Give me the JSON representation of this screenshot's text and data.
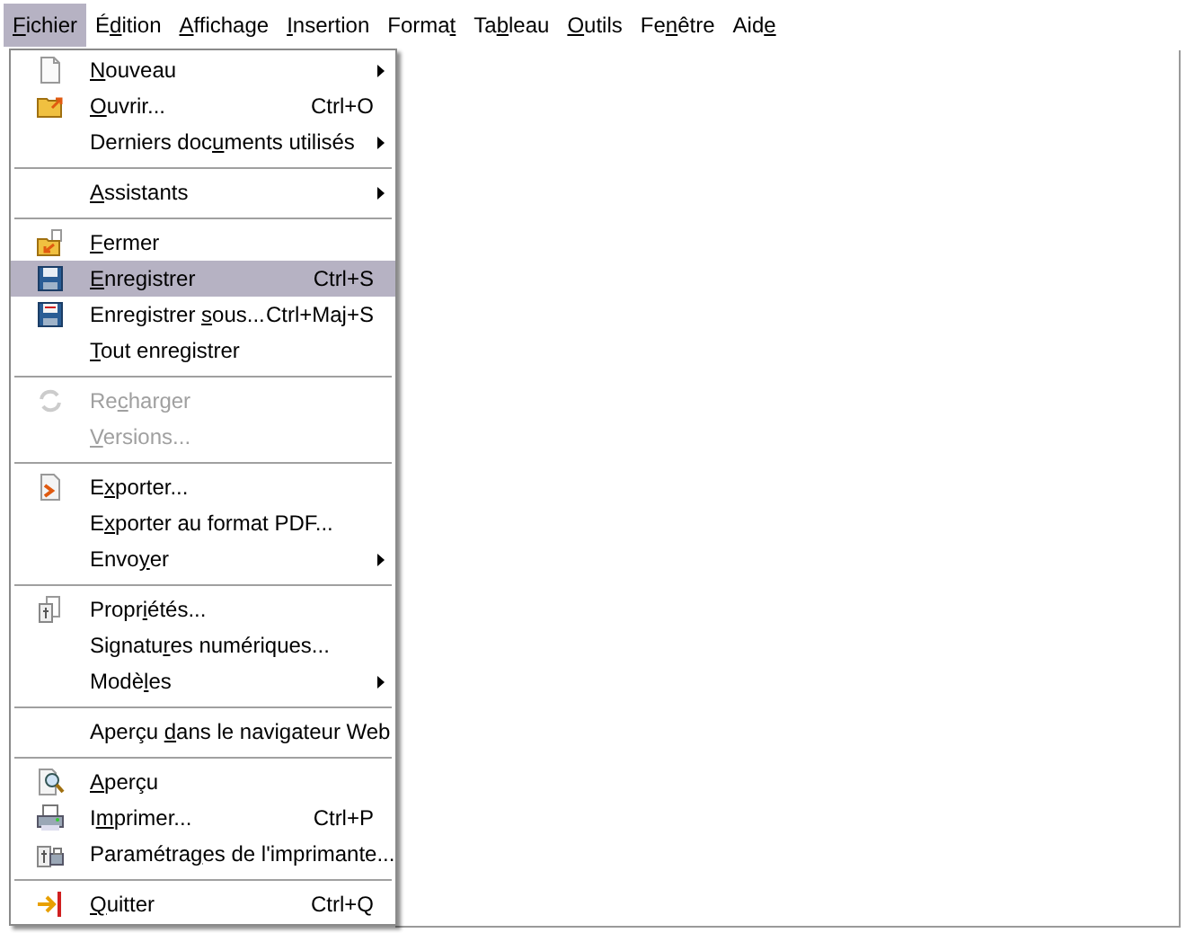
{
  "menubar": [
    {
      "key": "F",
      "after": "ichier",
      "selected": true
    },
    {
      "before": "É",
      "key": "d",
      "after": "ition",
      "selected": false
    },
    {
      "key": "A",
      "after": "ffichage",
      "selected": false
    },
    {
      "key": "I",
      "after": "nsertion",
      "selected": false
    },
    {
      "before": "Forma",
      "key": "t",
      "selected": false
    },
    {
      "before": "Ta",
      "key": "b",
      "after": "leau",
      "selected": false
    },
    {
      "key": "O",
      "after": "utils",
      "selected": false
    },
    {
      "before": "Fe",
      "key": "n",
      "after": "être",
      "selected": false
    },
    {
      "before": "Aid",
      "key": "e",
      "selected": false
    }
  ],
  "menu": [
    {
      "kind": "item",
      "key": "N",
      "after": "ouveau",
      "submenu": true,
      "selected": false,
      "disabled": false
    },
    {
      "kind": "item",
      "key": "O",
      "after": "uvrir...",
      "shortcut": "Ctrl+O",
      "submenu": false,
      "selected": false,
      "disabled": false
    },
    {
      "kind": "item",
      "before": "Derniers doc",
      "key": "u",
      "after": "ments utilisés",
      "submenu": true,
      "selected": false,
      "disabled": false
    },
    {
      "kind": "separator"
    },
    {
      "kind": "item",
      "key": "A",
      "after": "ssistants",
      "submenu": true,
      "selected": false,
      "disabled": false
    },
    {
      "kind": "separator"
    },
    {
      "kind": "item",
      "key": "F",
      "after": "ermer",
      "submenu": false,
      "selected": false,
      "disabled": false
    },
    {
      "kind": "item",
      "key": "E",
      "after": "nregistrer",
      "shortcut": "Ctrl+S",
      "submenu": false,
      "selected": true,
      "disabled": false
    },
    {
      "kind": "item",
      "before": "Enregistrer ",
      "key": "s",
      "after": "ous...",
      "shortcut": "Ctrl+Maj+S",
      "submenu": false,
      "selected": false,
      "disabled": false
    },
    {
      "kind": "item",
      "key": "T",
      "after": "out enregistrer",
      "submenu": false,
      "selected": false,
      "disabled": false
    },
    {
      "kind": "separator"
    },
    {
      "kind": "item",
      "before": "Re",
      "key": "c",
      "after": "harger",
      "submenu": false,
      "selected": false,
      "disabled": true
    },
    {
      "kind": "item",
      "key": "V",
      "after": "ersions...",
      "submenu": false,
      "selected": false,
      "disabled": true
    },
    {
      "kind": "separator"
    },
    {
      "kind": "item",
      "before": "E",
      "key": "x",
      "after": "porter...",
      "submenu": false,
      "selected": false,
      "disabled": false
    },
    {
      "kind": "item",
      "before": "E",
      "key": "x",
      "after": "porter au format PDF...",
      "submenu": false,
      "selected": false,
      "disabled": false
    },
    {
      "kind": "item",
      "before": "Envo",
      "key": "y",
      "after": "er",
      "submenu": true,
      "selected": false,
      "disabled": false
    },
    {
      "kind": "separator"
    },
    {
      "kind": "item",
      "before": "Propr",
      "key": "i",
      "after": "étés...",
      "submenu": false,
      "selected": false,
      "disabled": false
    },
    {
      "kind": "item",
      "before": "Signatu",
      "key": "r",
      "after": "es numériques...",
      "submenu": false,
      "selected": false,
      "disabled": false
    },
    {
      "kind": "item",
      "before": "Modè",
      "key": "l",
      "after": "es",
      "submenu": true,
      "selected": false,
      "disabled": false
    },
    {
      "kind": "separator"
    },
    {
      "kind": "item",
      "before": "Aperçu ",
      "key": "d",
      "after": "ans le navigateur Web",
      "submenu": false,
      "selected": false,
      "disabled": false
    },
    {
      "kind": "separator"
    },
    {
      "kind": "item",
      "key": "A",
      "after": "perçu",
      "submenu": false,
      "selected": false,
      "disabled": false
    },
    {
      "kind": "item",
      "before": "I",
      "key": "m",
      "after": "primer...",
      "shortcut": "Ctrl+P",
      "submenu": false,
      "selected": false,
      "disabled": false
    },
    {
      "kind": "item",
      "before": "Paramétra",
      "key": "g",
      "after": "es de l'imprimante...",
      "submenu": false,
      "selected": false,
      "disabled": false
    },
    {
      "kind": "separator"
    },
    {
      "kind": "item",
      "key": "Q",
      "after": "uitter",
      "shortcut": "Ctrl+Q",
      "submenu": false,
      "selected": false,
      "disabled": false
    }
  ]
}
